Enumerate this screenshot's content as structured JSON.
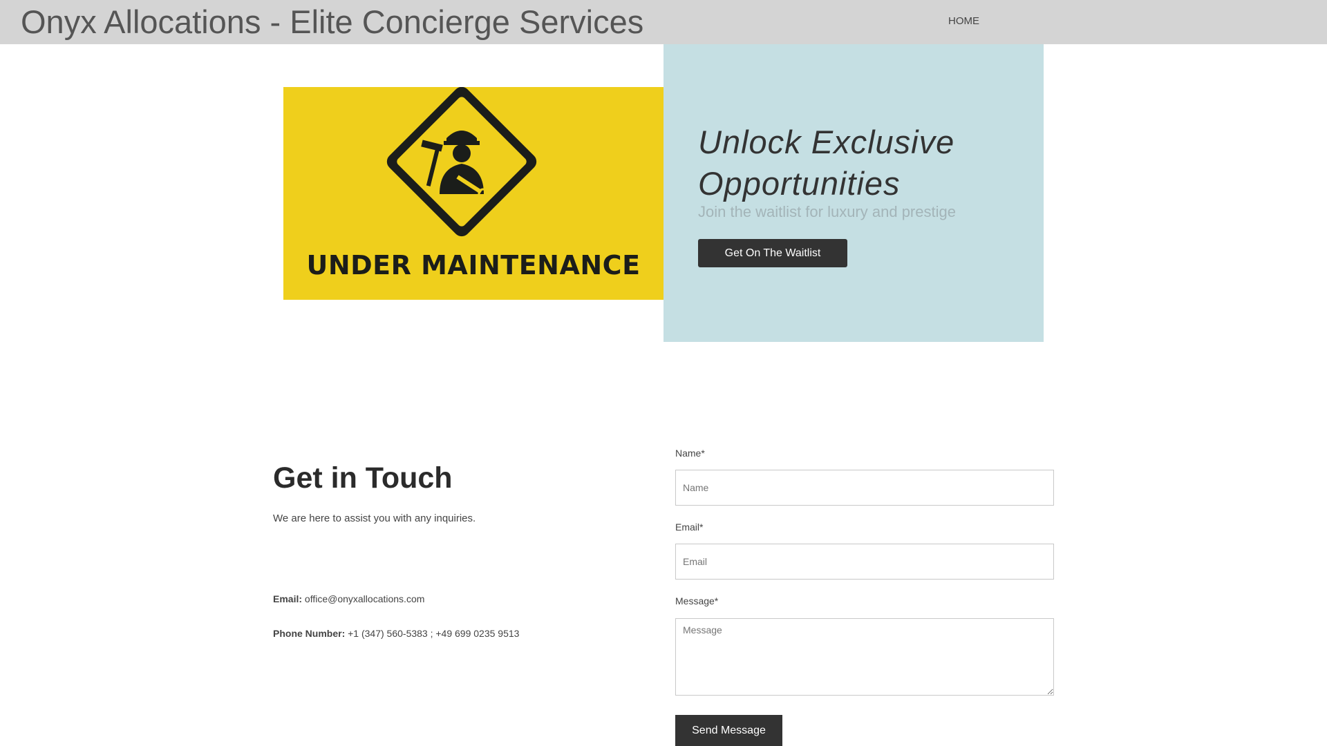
{
  "header": {
    "site_title": "Onyx Allocations - Elite Concierge Services",
    "nav": {
      "home": "HOME"
    }
  },
  "hero": {
    "image_text": "UNDER MAINTENANCE",
    "image_icon": "construction-worker-sign-icon",
    "title": "Unlock Exclusive Opportunities",
    "subtitle": "Join the waitlist for luxury and prestige",
    "cta_label": "Get On The Waitlist"
  },
  "contact": {
    "heading": "Get in Touch",
    "description": "We are here to assist you with any inquiries.",
    "email_label": "Email:",
    "email_value": "office@onyxallocations.com",
    "phone_label": "Phone Number:",
    "phone_value": "+1 (347) 560-5383  ;  +49 699 0235 9513"
  },
  "form": {
    "name_label": "Name*",
    "name_placeholder": "Name",
    "email_label": "Email*",
    "email_placeholder": "Email",
    "message_label": "Message*",
    "message_placeholder": "Message",
    "submit_label": "Send Message"
  },
  "colors": {
    "header_bg": "#d4d4d4",
    "hero_panel_bg": "#c5dfe3",
    "maintenance_yellow": "#efcf1c",
    "button_dark": "#333333"
  }
}
